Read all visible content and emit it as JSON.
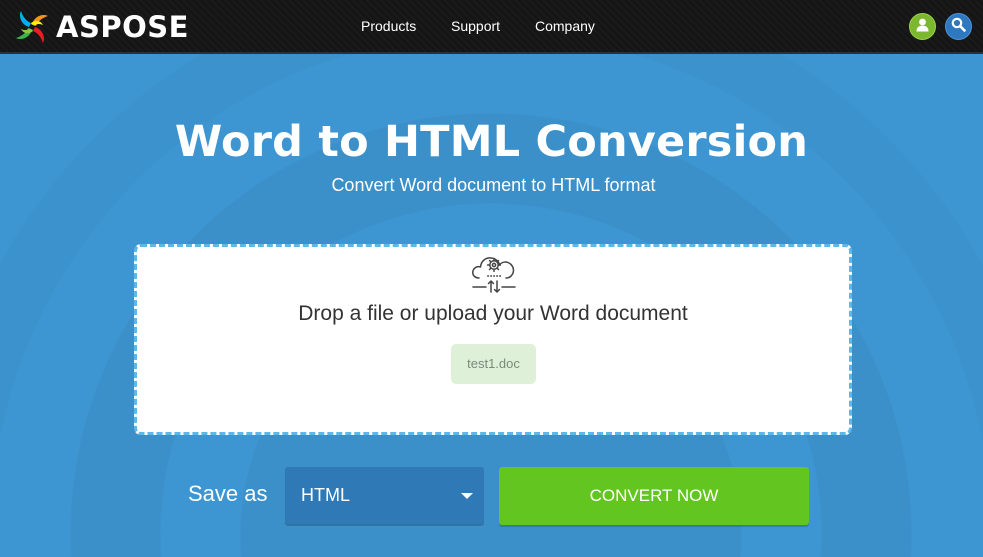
{
  "brand": {
    "name": "ASPOSE",
    "logo_icon": "aspose-swirl-logo-icon"
  },
  "nav": {
    "items": [
      {
        "label": "Products"
      },
      {
        "label": "Support"
      },
      {
        "label": "Company"
      }
    ],
    "user_icon": "user-icon",
    "search_icon": "search-icon"
  },
  "hero": {
    "title": "Word to HTML Conversion",
    "subtitle": "Convert Word document to HTML format"
  },
  "dropzone": {
    "icon": "cloud-upload-gear-icon",
    "prompt": "Drop a file or upload your Word document",
    "file_name": "test1.doc"
  },
  "save": {
    "label": "Save as",
    "selected_format": "HTML",
    "convert_label": "CONVERT NOW"
  },
  "colors": {
    "hero_bg": "#3d95d1",
    "navbar_bg": "#151515",
    "convert_green": "#63c51f",
    "select_blue": "#2f7ab6",
    "dropzone_border": "#5cb8e6",
    "file_chip_bg": "#dff0d8"
  }
}
